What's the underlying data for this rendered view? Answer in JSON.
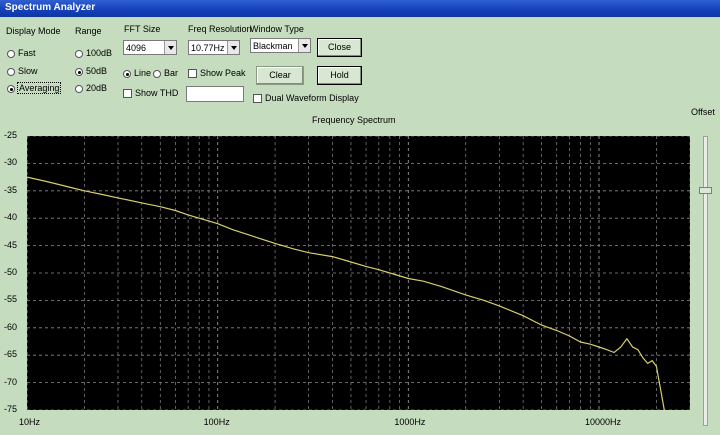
{
  "window": {
    "title": "Spectrum Analyzer"
  },
  "display_mode": {
    "label": "Display Mode",
    "options": [
      "Fast",
      "Slow",
      "Averaging"
    ],
    "selected": "Averaging"
  },
  "range": {
    "label": "Range",
    "options": [
      "100dB",
      "50dB",
      "20dB"
    ],
    "selected": "50dB"
  },
  "fft_size": {
    "label": "FFT Size",
    "value": "4096"
  },
  "plot_style": {
    "options": [
      "Line",
      "Bar"
    ],
    "selected": "Line"
  },
  "show_thd": {
    "label": "Show THD",
    "checked": false
  },
  "freq_resolution": {
    "label": "Freq Resolution",
    "value": "10.77Hz"
  },
  "show_peak": {
    "label": "Show Peak",
    "checked": false,
    "value": ""
  },
  "window_type": {
    "label": "Window Type",
    "value": "Blackman"
  },
  "buttons": {
    "close": "Close",
    "clear": "Clear",
    "hold": "Hold"
  },
  "dual_waveform": {
    "label": "Dual Waveform Display",
    "checked": false
  },
  "offset": {
    "label": "Offset"
  },
  "chart_data": {
    "type": "line",
    "title": "Frequency Spectrum",
    "xscale": "log",
    "xlim": [
      10,
      30000
    ],
    "ylim": [
      -75,
      -25
    ],
    "grid": true,
    "background": "#000000",
    "line_color": "#d6cf6a",
    "grid_color": "#8a8a8a",
    "yticks": [
      "-25",
      "-30",
      "-35",
      "-40",
      "-45",
      "-50",
      "-55",
      "-60",
      "-65",
      "-70",
      "-75"
    ],
    "xticks": [
      {
        "v": 10,
        "label": "10Hz"
      },
      {
        "v": 100,
        "label": "100Hz"
      },
      {
        "v": 1000,
        "label": "1000Hz"
      },
      {
        "v": 10000,
        "label": "10000Hz"
      }
    ],
    "x": [
      10,
      13,
      17,
      20,
      25,
      30,
      40,
      50,
      60,
      70,
      80,
      100,
      120,
      150,
      200,
      250,
      300,
      400,
      500,
      600,
      700,
      800,
      1000,
      1200,
      1500,
      2000,
      2500,
      3000,
      4000,
      5000,
      6000,
      7000,
      8000,
      9000,
      10000,
      11000,
      12000,
      13000,
      14000,
      15000,
      16000,
      17000,
      18000,
      19000,
      20000,
      22000
    ],
    "y": [
      -32.5,
      -33.4,
      -34.4,
      -35.0,
      -35.7,
      -36.3,
      -37.2,
      -37.9,
      -38.6,
      -39.4,
      -40.0,
      -41.0,
      -42.1,
      -43.2,
      -44.6,
      -45.6,
      -46.3,
      -47.0,
      -48.0,
      -48.8,
      -49.4,
      -50.0,
      -51.0,
      -51.5,
      -52.5,
      -54.0,
      -55.0,
      -56.0,
      -57.8,
      -59.5,
      -60.5,
      -61.5,
      -62.6,
      -63.0,
      -63.5,
      -64.0,
      -64.5,
      -63.5,
      -62.0,
      -63.5,
      -64.0,
      -65.5,
      -66.5,
      -66.0,
      -67.0,
      -75.0
    ]
  }
}
